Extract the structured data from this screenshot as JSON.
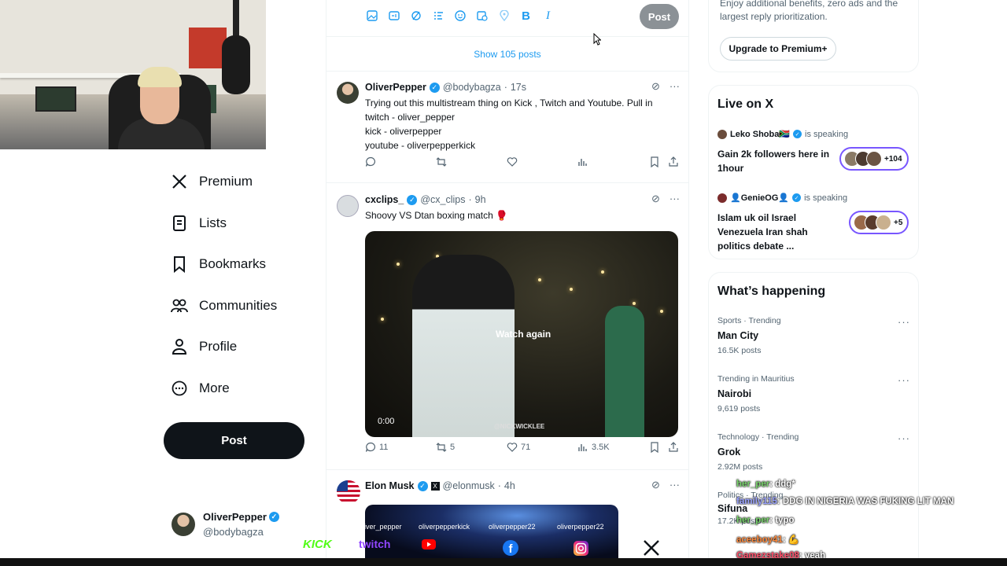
{
  "nav": {
    "items": [
      {
        "label": "Premium",
        "icon": "x-logo-icon"
      },
      {
        "label": "Lists",
        "icon": "list-icon"
      },
      {
        "label": "Bookmarks",
        "icon": "bookmark-icon"
      },
      {
        "label": "Communities",
        "icon": "communities-icon"
      },
      {
        "label": "Profile",
        "icon": "profile-icon"
      },
      {
        "label": "More",
        "icon": "more-circle-icon"
      }
    ],
    "post_label": "Post",
    "account": {
      "name": "OliverPepper",
      "handle": "@bodybagza"
    }
  },
  "composer": {
    "tools": [
      "image-icon",
      "gif-icon",
      "grok-icon",
      "poll-icon",
      "emoji-icon",
      "schedule-icon",
      "location-icon",
      "bold-icon",
      "italic-icon"
    ],
    "post_label": "Post"
  },
  "feed": {
    "show_posts": "Show 105 posts",
    "posts": [
      {
        "name": "OliverPepper",
        "handle": "@bodybagza",
        "time": "17s",
        "lines": [
          "Trying out this multistream thing on Kick , Twitch and Youtube. Pull in",
          "twitch - oliver_pepper",
          "kick - oliverpepper",
          "youtube - oliverpepperkick"
        ]
      },
      {
        "name": "cxclips_",
        "handle": "@cx_clips",
        "time": "9h",
        "text": "Shoovy VS Dtan boxing match 🥊",
        "media": {
          "overlay": "Watch again",
          "time": "0:00",
          "watermark": "@NICKWICKLEE"
        },
        "stats": {
          "replies": "11",
          "reposts": "5",
          "likes": "71",
          "views": "3.5K"
        }
      },
      {
        "name": "Elon Musk",
        "handle": "@elonmusk",
        "time": "4h"
      }
    ]
  },
  "premium": {
    "text": "Enjoy additional benefits, zero ads and the largest reply prioritization.",
    "button": "Upgrade to Premium+"
  },
  "live": {
    "title": "Live on X",
    "spaces": [
      {
        "host": "Leko Shoba🇿🇦",
        "status": "is speaking",
        "title": "Gain 2k followers here in 1hour",
        "count": "+104"
      },
      {
        "host": "👤GenieOG👤",
        "status": "is speaking",
        "title": "Islam uk oil Israel Venezuela Iran shah politics debate ...",
        "count": "+5"
      }
    ]
  },
  "happening": {
    "title": "What’s happening",
    "trends": [
      {
        "meta": "Sports · Trending",
        "name": "Man City",
        "count": "16.5K posts"
      },
      {
        "meta": "Trending in Mauritius",
        "name": "Nairobi",
        "count": "9,619 posts"
      },
      {
        "meta": "Technology · Trending",
        "name": "Grok",
        "count": "2.92M posts"
      },
      {
        "meta": "Politics · Trending",
        "name": "Sifuna",
        "count": "17.2K posts"
      }
    ]
  },
  "chat": [
    {
      "user": "her_per",
      "text": ": ddg*",
      "color": "#7bd66e"
    },
    {
      "user": "family115",
      "text": ": DDG IN NIGERIA WAS FUKING LIT MAN",
      "color": "#9aa3ff"
    },
    {
      "user": "her_per",
      "text": ": typo",
      "color": "#7bd66e"
    },
    {
      "user": "aceeboy41",
      "text": ": 💪",
      "color": "#ff8a3d"
    },
    {
      "user": "Gamezstake08",
      "text": ": yeah",
      "color": "#ff4f6b"
    }
  ],
  "banner": {
    "names": [
      "oliver_pepper",
      "oliverpepperkick",
      "oliverpepper22",
      "oliverpepper22"
    ],
    "platforms": [
      "KICK",
      "twitch",
      "youtube-icon",
      "facebook-icon",
      "instagram-icon",
      "x-logo-icon"
    ]
  },
  "colors": {
    "accent": "#1d9bf0",
    "text": "#0f1419",
    "muted": "#536471",
    "live_border": "#7856ff"
  }
}
